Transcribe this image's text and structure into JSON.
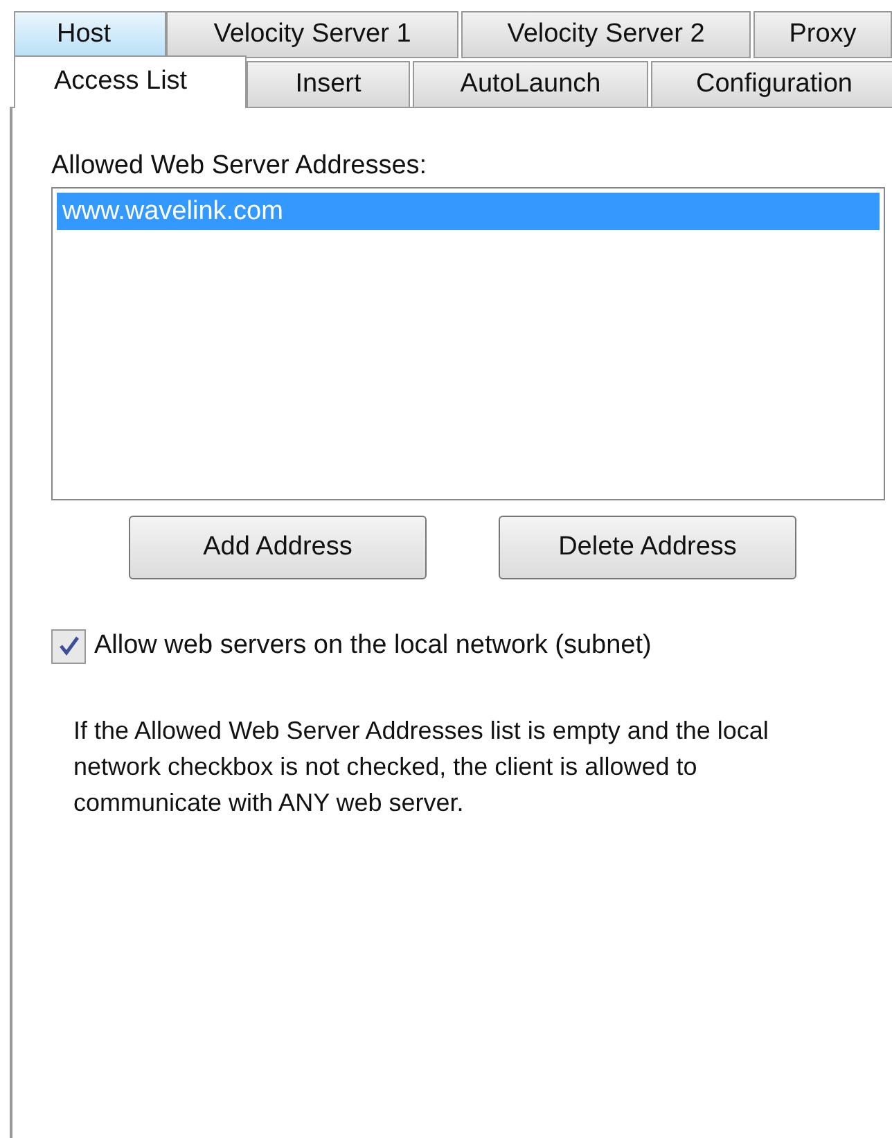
{
  "tab_rows": [
    {
      "tabs": [
        {
          "label": "Host",
          "selected": false,
          "hovered": true
        },
        {
          "label": "Velocity Server 1",
          "selected": false,
          "hovered": false
        },
        {
          "label": "Velocity Server 2",
          "selected": false,
          "hovered": false
        },
        {
          "label": "Proxy",
          "selected": false,
          "hovered": false
        }
      ]
    },
    {
      "tabs": [
        {
          "label": "Access List",
          "selected": true,
          "hovered": false
        },
        {
          "label": "Insert",
          "selected": false,
          "hovered": false
        },
        {
          "label": "AutoLaunch",
          "selected": false,
          "hovered": false
        },
        {
          "label": "Configuration",
          "selected": false,
          "hovered": false
        }
      ]
    }
  ],
  "address_list": {
    "label": "Allowed Web Server Addresses:",
    "items": [
      {
        "text": "www.wavelink.com",
        "selected": true
      }
    ]
  },
  "buttons": [
    "Add Address",
    "Delete Address"
  ],
  "local_network_checkbox": {
    "label": "Allow web servers on the local network (subnet)",
    "checked": true
  },
  "note": "If the Allowed Web Server Addresses list is empty and the local network checkbox is not checked, the client is allowed to communicate with ANY web server."
}
